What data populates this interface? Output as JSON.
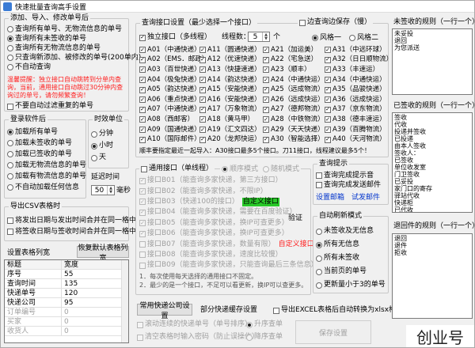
{
  "window": {
    "title": "快速批量查询高手设置"
  },
  "add_import": {
    "title": "添加、导入、修改单号后",
    "options": [
      "查询所有单号、无物流信息的单号",
      "查询所有未签收的单号",
      "查询所有无物流信息的单号",
      "只查询新添加、被修改的单号(200单内)",
      "不自动查询"
    ],
    "selected": 1,
    "warning": "温馨提醒：独立接口自动跳转到分单内查询，当前，通用接口自动跳过30分钟内查询过的单号，请勿频繁查询！",
    "no_auto_add_label": "不要自动过滤重复的单号"
  },
  "login_after": {
    "title": "登录软件后",
    "options": [
      "加载所有单号",
      "加载未签收的单号",
      "加载已签收的单号",
      "加载无物流信息的单号",
      "加载有物流信息的单号",
      "不自动加载任何信息"
    ],
    "selected": 0
  },
  "time_unit": {
    "title": "时效单位",
    "options": [
      "分钟",
      "小时",
      "天"
    ],
    "selected": 1
  },
  "delay": {
    "label": "延迟时间",
    "value": "50",
    "unit": "毫秒"
  },
  "export_csv": {
    "title": "导出CSV表格时",
    "items": [
      "将发出日期与发出时间合并在同一格中",
      "将签收日期与签收时间合并在同一格中"
    ]
  },
  "table_columns": {
    "title": "设置表格列宽",
    "reset_button": "恢复默认表格列宽",
    "headers": [
      "标题",
      "宽度"
    ],
    "rows": [
      {
        "name": "序号",
        "width": "55"
      },
      {
        "name": "查询时间",
        "width": "135"
      },
      {
        "name": "快递单号",
        "width": "120"
      },
      {
        "name": "快递公司",
        "width": "95"
      },
      {
        "name": "订单编号",
        "width": "0"
      },
      {
        "name": "买家",
        "width": "0"
      },
      {
        "name": "收货人",
        "width": "0"
      }
    ]
  },
  "query_interface": {
    "title": "查询接口设置（最少选择一个接口）",
    "edge_label": "边查询边保存（慢）",
    "independent_label": "独立接口（多线程）",
    "threads_label": "线程数：",
    "threads_value": "5",
    "threads_unit": "个",
    "style_options": [
      "风格一",
      "风格二"
    ],
    "style_selected": 0,
    "columns": [
      [
        "A01（中通快递）",
        "A02（EMS．邮政）",
        "A03（百世快递）",
        "A04（极兔快递）",
        "A05（韵达快递）",
        "A06（重点快递）",
        "A07（中通快递）",
        "A08（西邮客）",
        "A09（国通快递）",
        "A10（国际邮件）"
      ],
      [
        "A11（圆通快递）",
        "A12（优速快递）",
        "A13（快捷速递）",
        "A14（韵达快递）",
        "A15（安能快递）",
        "A16（安能快递）",
        "A17（万象物流）",
        "A18（黄马甲）",
        "A19（汇文四达）",
        "A20（龙邦快运）"
      ],
      [
        "A21（加运美）",
        "A22（宅急送）",
        "A23（顺丰）",
        "A24（中通快运）",
        "A25（远成物流）",
        "A26（远成快运）",
        "A27（德邦物流）",
        "A28（中铁物流）",
        "A29（天天快递）",
        "A30（智能选择）"
      ],
      [
        "A31（中远环球）",
        "A32（日日顺物流）",
        "A33（丰速运）",
        "A34（中通快运）",
        "A35（品骏快递）",
        "A36（远成快运）",
        "A37（京东物流）",
        "A38（德丰速运）",
        "A39（百腾物流）",
        "A40（天河物流）"
      ]
    ],
    "footnote": "顺丰要指定最近一起导入：A30接口最多5个接口。刀11接口，线程建议最多5个！"
  },
  "general_interface": {
    "title": "通用接口（单线程）",
    "modes": [
      "顺序模式",
      "随机模式"
    ],
    "items": [
      {
        "id": "接口B01",
        "note": "（能查询多家快递，第三方接口）"
      },
      {
        "id": "接口B02",
        "note": "（能查询多家快递，不限IP）"
      },
      {
        "id": "接口B03",
        "note": "（快递100的接口）"
      },
      {
        "id": "接口B04",
        "note": "（能查询多家快递，需要在百度验证）"
      },
      {
        "id": "接口B05",
        "note": "（能查询多家快递，换IP可查更多）"
      },
      {
        "id": "接口B06",
        "note": "（能查询多家快递，换IP可查更多）"
      },
      {
        "id": "接口B07",
        "note": "（能查询多家快递，数量有限）"
      },
      {
        "id": "接口B08",
        "note": "（能查询多家快递，速度比较慢）"
      },
      {
        "id": "接口B09",
        "note": "（能查询多家快递，只能查询最后三条信息）"
      }
    ],
    "custom_btn1": "自定义接口",
    "custom_btn2": "自定义接口",
    "verify_label": "验证",
    "footnotes": [
      "1．每次使用每天选择的通用接口不固定。",
      "2．最少的是一个接口，不足可以看更新，换IP可以查更多。"
    ]
  },
  "query_tip": {
    "title": "查询提示",
    "items": [
      "查询完成提示音",
      "查询完成发送邮件"
    ],
    "links": [
      "设置邮箱",
      "试发邮件"
    ]
  },
  "auto_refresh": {
    "title": "自动刷新模式",
    "options": [
      "未签收及无信息",
      "所有无信息",
      "所有未签收",
      "当前页的单号",
      "更新量小于3的单号"
    ],
    "selected": 1
  },
  "bottom": {
    "common_btn": "常用快递公司设置",
    "cache_label": "部分快递缓存设置",
    "export_excel": "导出EXCEL表格后自动转换为xlsx格式",
    "dis1": "滚动连续的快递单号（单号排序）",
    "dis1_radio": "升序查单",
    "dis2": "清空表格时输入密码（防止误操作）",
    "dis2_radio": "降序查单",
    "save_btn": "保存设置"
  },
  "unsigned_rules": {
    "title": "未签收的规则（一行一个）",
    "lines": [
      "未妥投",
      "退回",
      "为您派送"
    ]
  },
  "signed_rules": {
    "title": "已签收的规则（一行一个）",
    "lines": [
      "签收",
      "代收",
      "投递并签收",
      "已投递",
      "由本人签收",
      "签收人：",
      "已签收",
      "单位收发室",
      "门卫签收",
      "已妥投",
      "家门口的寄存",
      "驿站代收",
      "快递柜",
      "已代收",
      "代签收",
      "本人签收",
      "已送达",
      "快递超市",
      "派送",
      "投递"
    ]
  },
  "returned_rules": {
    "title": "退回件的规则（一行一个）",
    "lines": [
      "退回",
      "退件",
      "拒收"
    ]
  },
  "watermark": "创业号"
}
